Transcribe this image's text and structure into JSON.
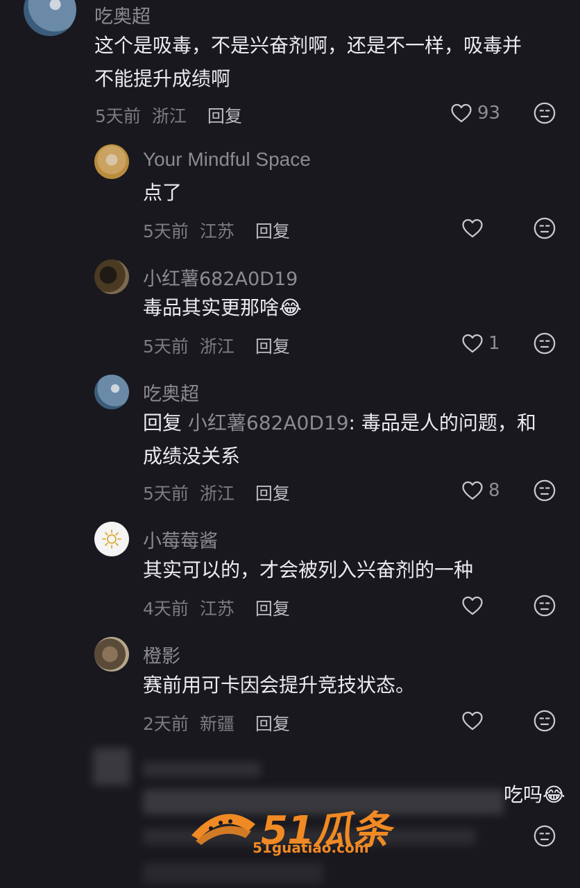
{
  "comments": [
    {
      "name": "吃奥超",
      "text_line1": "这个是吸毒，不是兴奋剂啊，还是不一样，吸毒并",
      "text_line2": "不能提升成绩啊",
      "time": "5天前",
      "location": "浙江",
      "reply_label": "回复",
      "likes": "93"
    },
    {
      "name": "Your Mindful Space",
      "text": "点了",
      "time": "5天前",
      "location": "江苏",
      "reply_label": "回复",
      "likes": ""
    },
    {
      "name": "小红薯682A0D19",
      "text": "毒品其实更那啥",
      "emoji": "😂",
      "time": "5天前",
      "location": "浙江",
      "reply_label": "回复",
      "likes": "1"
    },
    {
      "name": "吃奥超",
      "reply_prefix": "回复",
      "reply_target": "小红薯682A0D19",
      "text_line1": ": 毒品是人的问题，和",
      "text_line2": "成绩没关系",
      "time": "5天前",
      "location": "浙江",
      "reply_label": "回复",
      "likes": "8"
    },
    {
      "name": "小莓莓酱",
      "text": "其实可以的，才会被列入兴奋剂的一种",
      "time": "4天前",
      "location": "江苏",
      "reply_label": "回复",
      "likes": ""
    },
    {
      "name": "橙影",
      "text": "赛前用可卡因会提升竞技状态。",
      "time": "2天前",
      "location": "新疆",
      "reply_label": "回复",
      "likes": ""
    },
    {
      "text_tail": "吃吗",
      "emoji": "😂"
    }
  ],
  "watermark": {
    "main": "51瓜条",
    "sub": "51guatiao.com"
  },
  "colors": {
    "background": "#19181e",
    "accent_watermark": "#f08a24"
  }
}
